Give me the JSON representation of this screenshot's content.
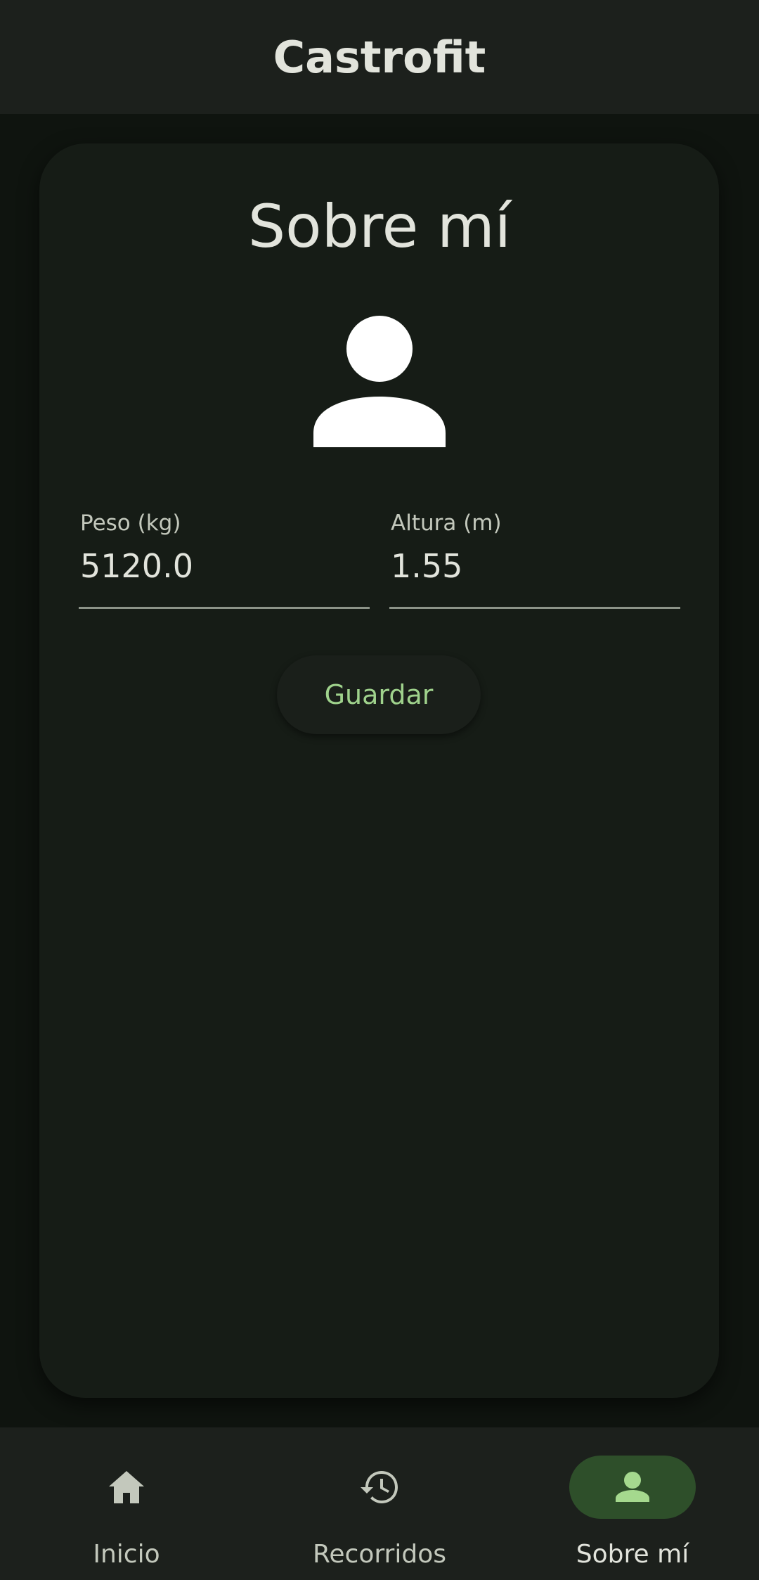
{
  "app_bar": {
    "title": "Castrofit"
  },
  "card": {
    "title": "Sobre mí",
    "avatar_icon": "person-icon",
    "fields": [
      {
        "label": "Peso (kg)",
        "value": "5120.0"
      },
      {
        "label": "Altura (m)",
        "value": "1.55"
      }
    ],
    "save_label": "Guardar"
  },
  "bottom_nav": {
    "items": [
      {
        "label": "Inicio",
        "icon": "home-icon",
        "active": false
      },
      {
        "label": "Recorridos",
        "icon": "history-icon",
        "active": false
      },
      {
        "label": "Sobre mí",
        "icon": "person-icon",
        "active": true
      }
    ]
  },
  "colors": {
    "background": "#0f140f",
    "surface": "#161c16",
    "bar": "#1c201c",
    "accent": "#9fd28c",
    "active_pill": "#2e4f2a"
  }
}
